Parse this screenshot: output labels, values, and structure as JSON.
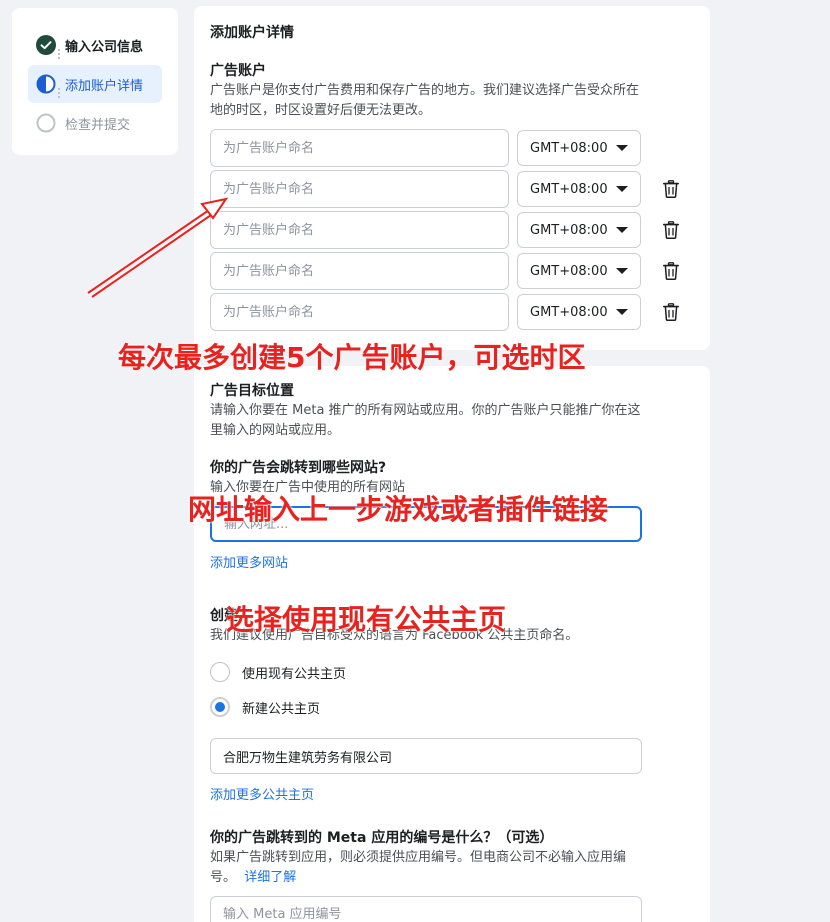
{
  "stepper": {
    "steps": [
      {
        "label": "输入公司信息",
        "state": "done"
      },
      {
        "label": "添加账户详情",
        "state": "active"
      },
      {
        "label": "检查并提交",
        "state": "pending"
      }
    ]
  },
  "accounts_card": {
    "title": "添加账户详情",
    "section_title": "广告账户",
    "section_desc_line1": "广告账户是你支付广告费用和保存广告的地方。我们建议选择广告受众所在",
    "section_desc_line2": "地的时区，时区设置好后便无法更改。",
    "account_placeholder": "为广告账户命名",
    "rows": [
      {
        "timezone": "GMT+08:00",
        "deletable": false
      },
      {
        "timezone": "GMT+08:00",
        "deletable": true
      },
      {
        "timezone": "GMT+08:00",
        "deletable": true
      },
      {
        "timezone": "GMT+08:00",
        "deletable": true
      },
      {
        "timezone": "GMT+08:00",
        "deletable": true
      }
    ]
  },
  "targets_card": {
    "section_title": "广告目标位置",
    "section_desc_line1": "请输入你要在 Meta 推广的所有网站或应用。你的广告账户只能推广你在这",
    "section_desc_line2": "里输入的网站或应用。",
    "website_q": "你的广告会跳转到哪些网站?",
    "website_hint": "输入你要在广告中使用的所有网站",
    "website_placeholder": "输入网址...",
    "add_website_link": "添加更多网站",
    "page_q": "创建",
    "page_hint": "我们建议使用广告目标受众的语言为 Facebook 公共主页命名。",
    "radio_existing": "使用现有公共主页",
    "radio_new": "新建公共主页",
    "page_name_value": "合肥万物生建筑劳务有限公司",
    "add_page_link": "添加更多公共主页",
    "app_q": "你的广告跳转到的 Meta 应用的编号是什么？（可选）",
    "app_desc_line1": "如果广告跳转到应用，则必须提供应用编号。但电商公司不必输入应用编",
    "app_desc_line2": "号。",
    "learn_more_link": "详细了解",
    "app_placeholder": "输入 Meta 应用编号"
  },
  "annotations": {
    "accounts_note": "每次最多创建5个广告账户，可选时区",
    "website_note": "网址输入上一步游戏或者插件链接",
    "page_note": "选择使用现有公共主页"
  },
  "colors": {
    "accent": "#1b74e4",
    "annotation": "#e8231f",
    "done_check": "#1f4a3c"
  }
}
